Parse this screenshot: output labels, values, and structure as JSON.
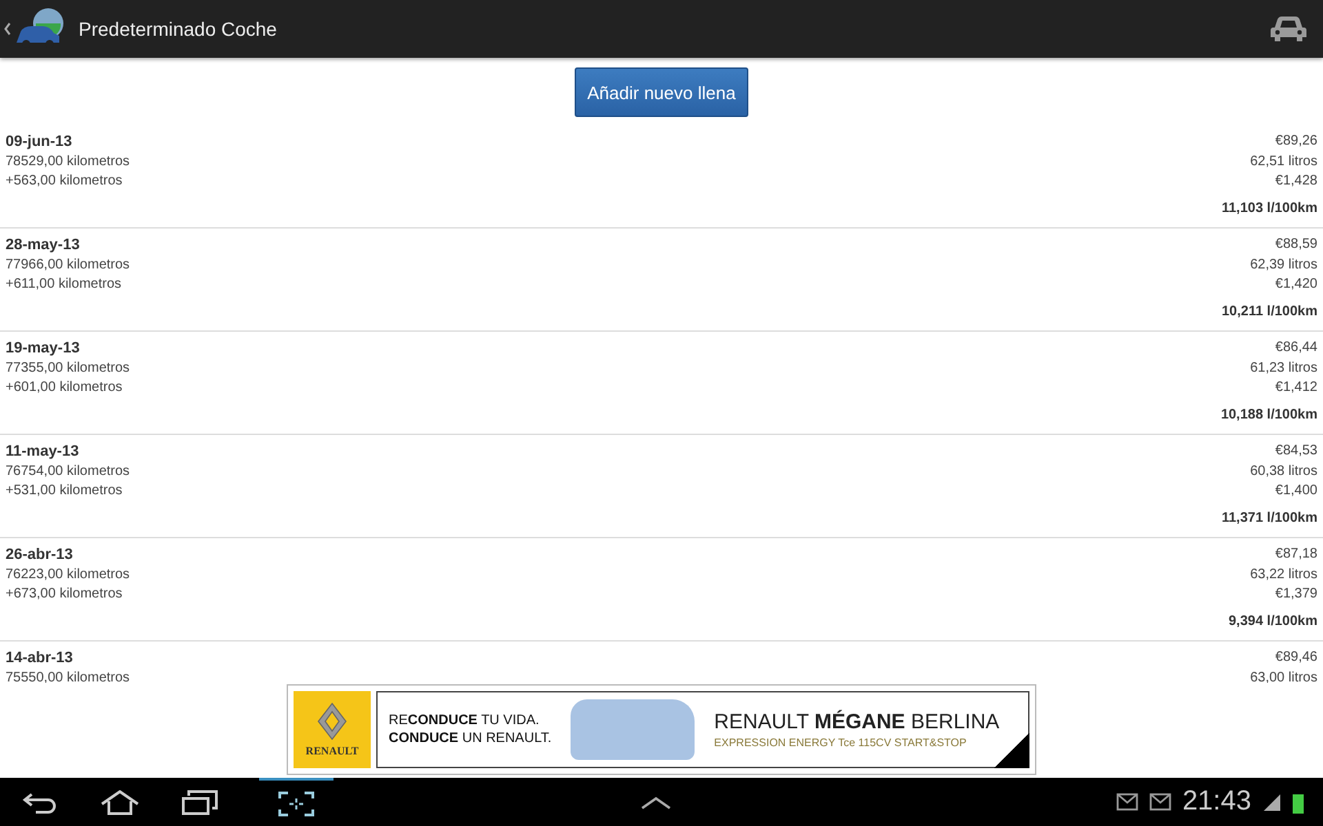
{
  "action_bar": {
    "title": "Predeterminado Coche"
  },
  "add_button": {
    "label": "Añadir nuevo llena"
  },
  "entries": [
    {
      "date": "09-jun-13",
      "odometer": "78529,00 kilometros",
      "distance": "+563,00 kilometros",
      "cost": "€89,26",
      "volume": "62,51 litros",
      "unit_price": "€1,428",
      "consumption": "11,103 l/100km"
    },
    {
      "date": "28-may-13",
      "odometer": "77966,00 kilometros",
      "distance": "+611,00 kilometros",
      "cost": "€88,59",
      "volume": "62,39 litros",
      "unit_price": "€1,420",
      "consumption": "10,211 l/100km"
    },
    {
      "date": "19-may-13",
      "odometer": "77355,00 kilometros",
      "distance": "+601,00 kilometros",
      "cost": "€86,44",
      "volume": "61,23 litros",
      "unit_price": "€1,412",
      "consumption": "10,188 l/100km"
    },
    {
      "date": "11-may-13",
      "odometer": "76754,00 kilometros",
      "distance": "+531,00 kilometros",
      "cost": "€84,53",
      "volume": "60,38 litros",
      "unit_price": "€1,400",
      "consumption": "11,371 l/100km"
    },
    {
      "date": "26-abr-13",
      "odometer": "76223,00 kilometros",
      "distance": "+673,00 kilometros",
      "cost": "€87,18",
      "volume": "63,22 litros",
      "unit_price": "€1,379",
      "consumption": "9,394 l/100km"
    },
    {
      "date": "14-abr-13",
      "odometer": "75550,00 kilometros",
      "cost": "€89,46",
      "volume": "63,00 litros"
    }
  ],
  "ad": {
    "brand": "RENAULT",
    "slogan_1": "RE**CONDUCE** TU VIDA.",
    "slogan_2": "**CONDUCE** UN RENAULT.",
    "model": "RENAULT **MÉGANE** BERLINA",
    "version": "EXPRESSION ENERGY Tce 115CV START&STOP"
  },
  "system_bar": {
    "clock": "21:43"
  }
}
